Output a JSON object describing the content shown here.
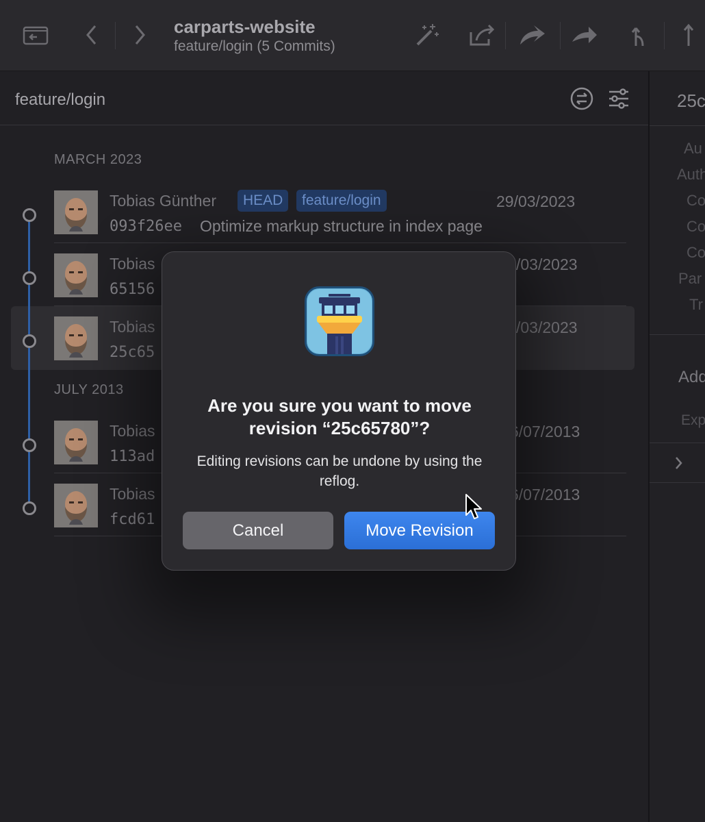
{
  "toolbar": {
    "repo_title": "carparts-website",
    "repo_subtitle": "feature/login (5 Commits)",
    "icons": [
      "repository-icon",
      "back-icon",
      "forward-icon",
      "magic-wand-icon",
      "share-icon",
      "undo-icon",
      "redo-icon",
      "branch-icon",
      "push-icon"
    ]
  },
  "history": {
    "panel_title": "feature/login",
    "groups": [
      {
        "month": "MARCH 2023",
        "commits": [
          {
            "author": "Tobias Günther",
            "hash": "093f26ee",
            "message": "Optimize markup structure in index page",
            "date": "29/03/2023",
            "tags": [
              "HEAD",
              "feature/login"
            ]
          },
          {
            "author": "Tobias",
            "hash": "65156",
            "message": "",
            "date": "/03/2023",
            "tags": []
          },
          {
            "author": "Tobias",
            "hash": "25c65",
            "message": "",
            "date": "/03/2023",
            "tags": []
          }
        ]
      },
      {
        "month": "JULY 2013",
        "commits": [
          {
            "author": "Tobias",
            "hash": "113ad",
            "message": "",
            "date": "6/07/2013",
            "tags": []
          },
          {
            "author": "Tobias",
            "hash": "fcd61",
            "message": "",
            "date": "6/07/2013",
            "tags": []
          }
        ]
      }
    ]
  },
  "detail_pane": {
    "hash": "25c",
    "fields": [
      "Au",
      "Auth",
      "Co",
      "Co",
      "Co",
      "Par",
      "Tr"
    ],
    "section": "Add",
    "exp": "Exp"
  },
  "dialog": {
    "title": "Are you sure you want to move revision “25c65780”?",
    "message": "Editing revisions can be undone by using the reflog.",
    "cancel_label": "Cancel",
    "confirm_label": "Move Revision"
  },
  "colors": {
    "accent": "#2b6fd6",
    "tag_bg": "#223a63",
    "tag_text": "#6c8fc9",
    "graph_line": "#2e5fa6"
  }
}
